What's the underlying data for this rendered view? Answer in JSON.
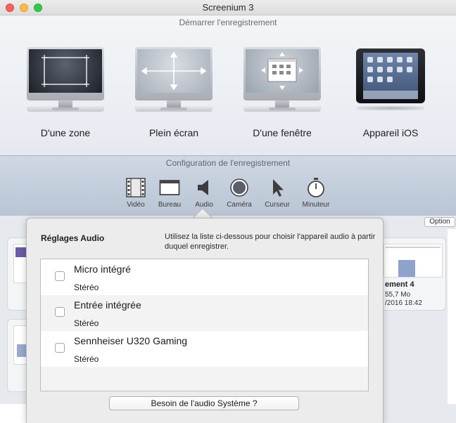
{
  "window": {
    "title": "Screenium 3"
  },
  "start_section": {
    "title": "Démarrer l'enregistrement",
    "modes": [
      {
        "label": "D'une zone",
        "icon": "monitor-zone-icon"
      },
      {
        "label": "Plein écran",
        "icon": "monitor-fullscreen-icon"
      },
      {
        "label": "D'une fenêtre",
        "icon": "monitor-window-icon"
      },
      {
        "label": "Appareil iOS",
        "icon": "ipad-icon"
      }
    ]
  },
  "config_section": {
    "title": "Configuration de l'enregistrement",
    "tabs": [
      {
        "label": "Vidéo",
        "icon": "film-icon"
      },
      {
        "label": "Bureau",
        "icon": "desktop-icon"
      },
      {
        "label": "Audio",
        "icon": "speaker-icon",
        "selected": true
      },
      {
        "label": "Caméra",
        "icon": "camera-icon"
      },
      {
        "label": "Curseur",
        "icon": "cursor-icon"
      },
      {
        "label": "Minuteur",
        "icon": "timer-icon"
      }
    ]
  },
  "recordings": {
    "option_label": "Option",
    "partial": [
      {
        "name": "ement 4",
        "size": "55,7 Mo",
        "date": "/2016 18:42"
      }
    ]
  },
  "audio_popover": {
    "title": "Réglages Audio",
    "help": "Utilisez la liste ci-dessous pour choisir l'appareil audio à partir duquel enregistrer.",
    "devices": [
      {
        "name": "Micro intégré",
        "channels": "Stéréo",
        "checked": false
      },
      {
        "name": "Entrée intégrée",
        "channels": "Stéréo",
        "checked": false
      },
      {
        "name": "Sennheiser U320 Gaming",
        "channels": "Stéréo",
        "checked": false
      }
    ],
    "system_audio_button": "Besoin de l'audio Système ?"
  },
  "colors": {
    "accent_blue": "#2f63c9",
    "config_bg": "#c4cfdd",
    "popover_bg": "#ececec"
  }
}
